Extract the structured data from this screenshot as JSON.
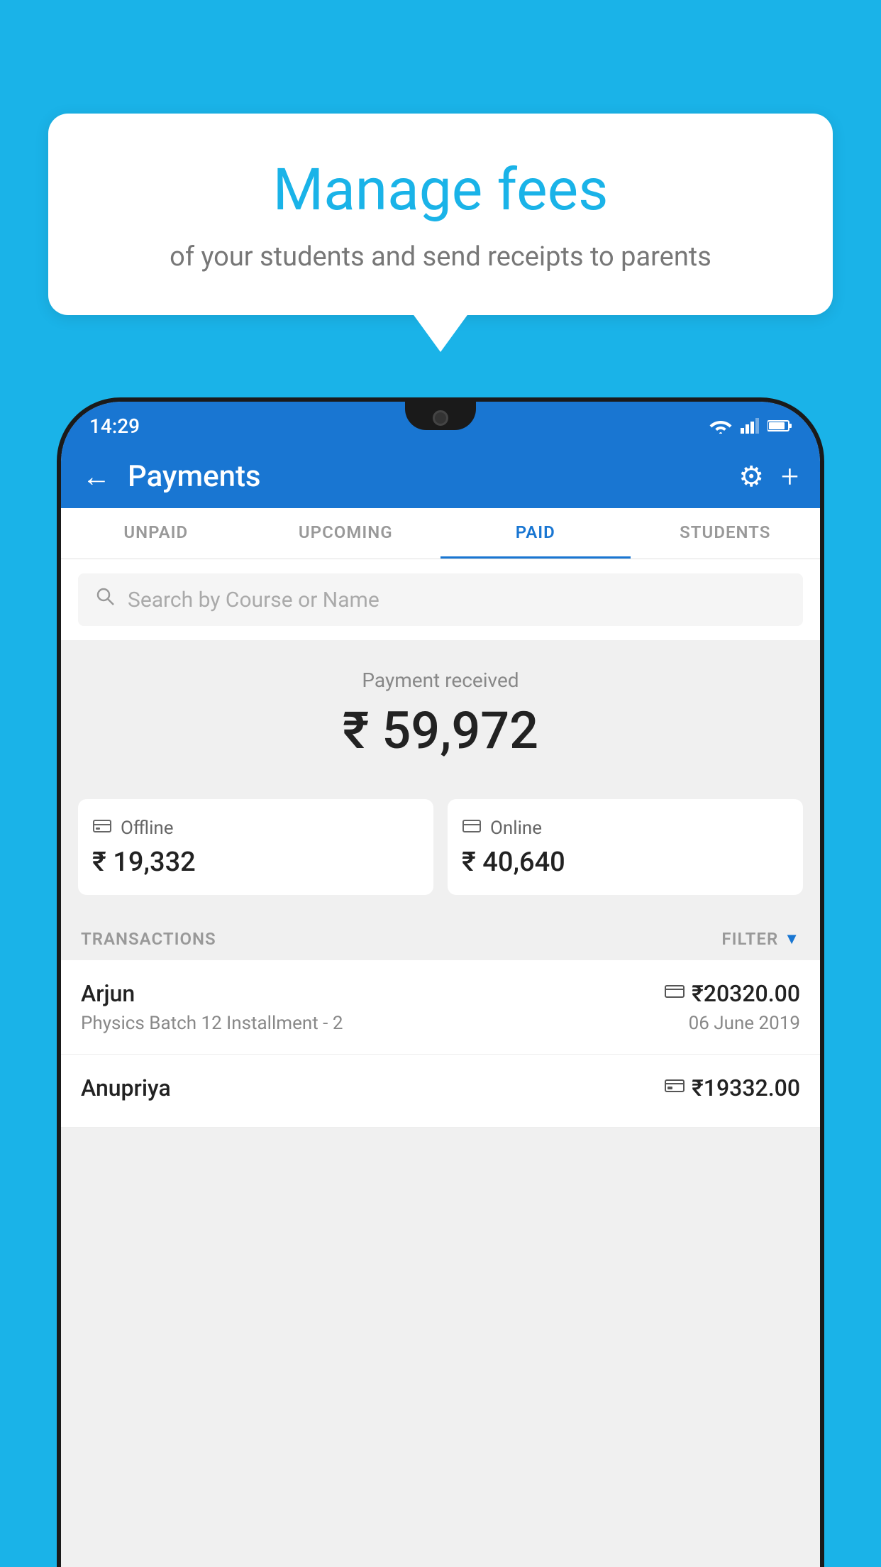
{
  "background_color": "#1ab3e8",
  "bubble": {
    "title": "Manage fees",
    "subtitle": "of your students and send receipts to parents"
  },
  "status_bar": {
    "time": "14:29",
    "icons": [
      "wifi",
      "signal",
      "battery"
    ]
  },
  "header": {
    "title": "Payments",
    "back_label": "←",
    "gear_label": "⚙",
    "plus_label": "+"
  },
  "tabs": [
    {
      "label": "UNPAID",
      "active": false
    },
    {
      "label": "UPCOMING",
      "active": false
    },
    {
      "label": "PAID",
      "active": true
    },
    {
      "label": "STUDENTS",
      "active": false
    }
  ],
  "search": {
    "placeholder": "Search by Course or Name"
  },
  "payment_summary": {
    "label": "Payment received",
    "amount": "₹ 59,972"
  },
  "payment_cards": [
    {
      "type": "Offline",
      "amount": "₹ 19,332",
      "icon": "💳"
    },
    {
      "type": "Online",
      "amount": "₹ 40,640",
      "icon": "💳"
    }
  ],
  "transactions_header": {
    "label": "TRANSACTIONS",
    "filter_label": "FILTER"
  },
  "transactions": [
    {
      "name": "Arjun",
      "course": "Physics Batch 12 Installment - 2",
      "amount": "₹20320.00",
      "date": "06 June 2019",
      "payment_type": "online"
    },
    {
      "name": "Anupriya",
      "course": "",
      "amount": "₹19332.00",
      "date": "",
      "payment_type": "offline"
    }
  ]
}
